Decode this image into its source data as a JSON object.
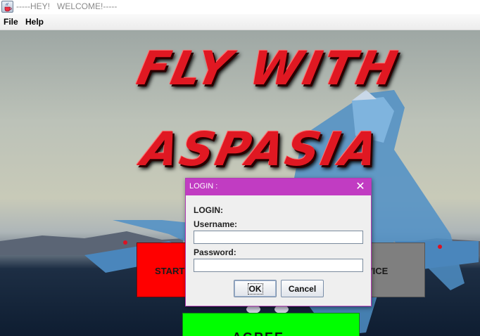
{
  "window": {
    "title": "-----HEY!   WELCOME!-----",
    "icon": "java-cup-icon"
  },
  "menu": {
    "items": [
      "File",
      "Help"
    ]
  },
  "hero": {
    "line1": "FLY WITH",
    "line2": "ASPASIA"
  },
  "main_buttons": {
    "start": "START",
    "service": "VICE",
    "green": "AGREE"
  },
  "colors": {
    "start_button": "#ff0000",
    "service_button": "#7f7f7f",
    "green_button": "#00ff00",
    "dialog_accent": "#c13cc2"
  },
  "login_dialog": {
    "title": "LOGIN :",
    "heading": "LOGIN:",
    "username_label": "Username:",
    "username_value": "",
    "password_label": "Password:",
    "password_value": "",
    "ok_label": "OK",
    "cancel_label": "Cancel"
  }
}
